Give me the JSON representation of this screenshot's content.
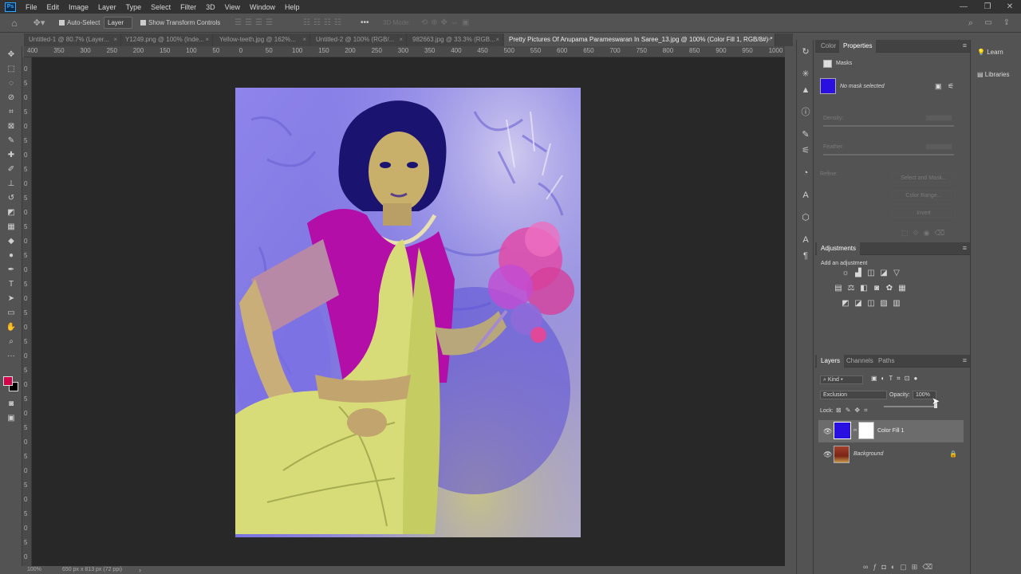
{
  "app": {
    "logo_text": "Ps"
  },
  "menu": [
    "File",
    "Edit",
    "Image",
    "Layer",
    "Type",
    "Select",
    "Filter",
    "3D",
    "View",
    "Window",
    "Help"
  ],
  "window_controls": {
    "minimize": "—",
    "restore": "❐",
    "close": "✕"
  },
  "options_bar": {
    "auto_select_label": "Auto-Select",
    "auto_select_target": "Layer",
    "show_transform_label": "Show Transform Controls",
    "mode_3d_label": "3D Mode:",
    "more_label": "•••"
  },
  "tabs": [
    {
      "label": "Untitled-1 @ 80.7% (Layer...",
      "active": false
    },
    {
      "label": "Y1249.png @ 100% (Inde...",
      "active": false
    },
    {
      "label": "Yellow-teeth.jpg @ 162%...",
      "active": false
    },
    {
      "label": "Untitled-2 @ 100% (RGB/...",
      "active": false
    },
    {
      "label": "982663.jpg @ 33.3% (RGB...",
      "active": false
    },
    {
      "label": "Pretty Pictures Of Anupama Parameswaran In Saree_13.jpg @ 100% (Color Fill 1, RGB/8#) *",
      "active": true
    }
  ],
  "ruler_h": [
    "400",
    "350",
    "300",
    "250",
    "200",
    "150",
    "100",
    "50",
    "0",
    "50",
    "100",
    "150",
    "200",
    "250",
    "300",
    "350",
    "400",
    "450",
    "500",
    "550",
    "600",
    "650",
    "700",
    "750",
    "800",
    "850",
    "900",
    "950",
    "1000"
  ],
  "ruler_v": [
    "0",
    "5",
    "0",
    "5",
    "0",
    "5",
    "0",
    "5",
    "0",
    "5",
    "0",
    "5",
    "0",
    "5",
    "0",
    "5",
    "0",
    "5",
    "0",
    "5",
    "0",
    "5",
    "0",
    "5",
    "0",
    "5",
    "0",
    "5",
    "0",
    "5",
    "0",
    "5",
    "0",
    "5",
    "0"
  ],
  "status": {
    "zoom": "100%",
    "doc_info": "650 px x 813 px (72 ppi)",
    "arrow": "›"
  },
  "colors": {
    "foreground": "#d4004a",
    "background": "#000000",
    "fill_layer": "#2a10e0"
  },
  "properties_panel": {
    "tab_color": "Color",
    "tab_properties": "Properties",
    "section": "Masks",
    "no_mask": "No mask selected",
    "density_label": "Density:",
    "feather_label": "Feather:",
    "refine_label": "Refine:",
    "select_mask_btn": "Select and Mask...",
    "color_range_btn": "Color Range...",
    "invert_btn": "Invert"
  },
  "adjustments_panel": {
    "title": "Adjustments",
    "subtitle": "Add an adjustment"
  },
  "layers_panel": {
    "tab_layers": "Layers",
    "tab_channels": "Channels",
    "tab_paths": "Paths",
    "kind_label": "Kind",
    "blend_mode": "Exclusion",
    "opacity_label": "Opacity:",
    "opacity_value": "100%",
    "lock_label": "Lock:",
    "layers": [
      {
        "name": "Color Fill 1",
        "selected": true,
        "locked": false
      },
      {
        "name": "Background",
        "selected": false,
        "locked": true
      }
    ]
  },
  "far_right": {
    "learn": "Learn",
    "libraries": "Libraries"
  }
}
